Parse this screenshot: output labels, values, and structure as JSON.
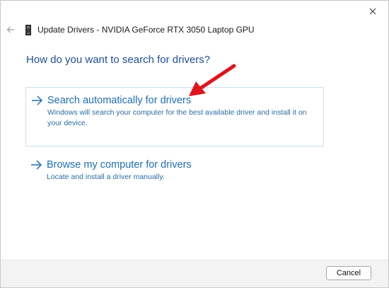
{
  "window": {
    "close_icon": "close-icon",
    "back_icon": "back-arrow-icon",
    "device_icon": "gpu-device-icon",
    "title": "Update Drivers - NVIDIA GeForce RTX 3050 Laptop GPU"
  },
  "main": {
    "heading": "How do you want to search for drivers?",
    "options": [
      {
        "icon": "arrow-right-icon",
        "title": "Search automatically for drivers",
        "description": "Windows will search your computer for the best available driver and install it on your device.",
        "selected": true
      },
      {
        "icon": "arrow-right-icon",
        "title": "Browse my computer for drivers",
        "description": "Locate and install a driver manually.",
        "selected": false
      }
    ],
    "annotation_icon": "red-pointer-arrow-icon"
  },
  "footer": {
    "cancel_label": "Cancel"
  },
  "colors": {
    "heading": "#1f4e96",
    "option_title": "#1f6fb5",
    "option_desc": "#2b6aa8",
    "selected_border": "#cce0f2",
    "annotation": "#e0141c",
    "footer_bg": "#f3f3f3"
  }
}
